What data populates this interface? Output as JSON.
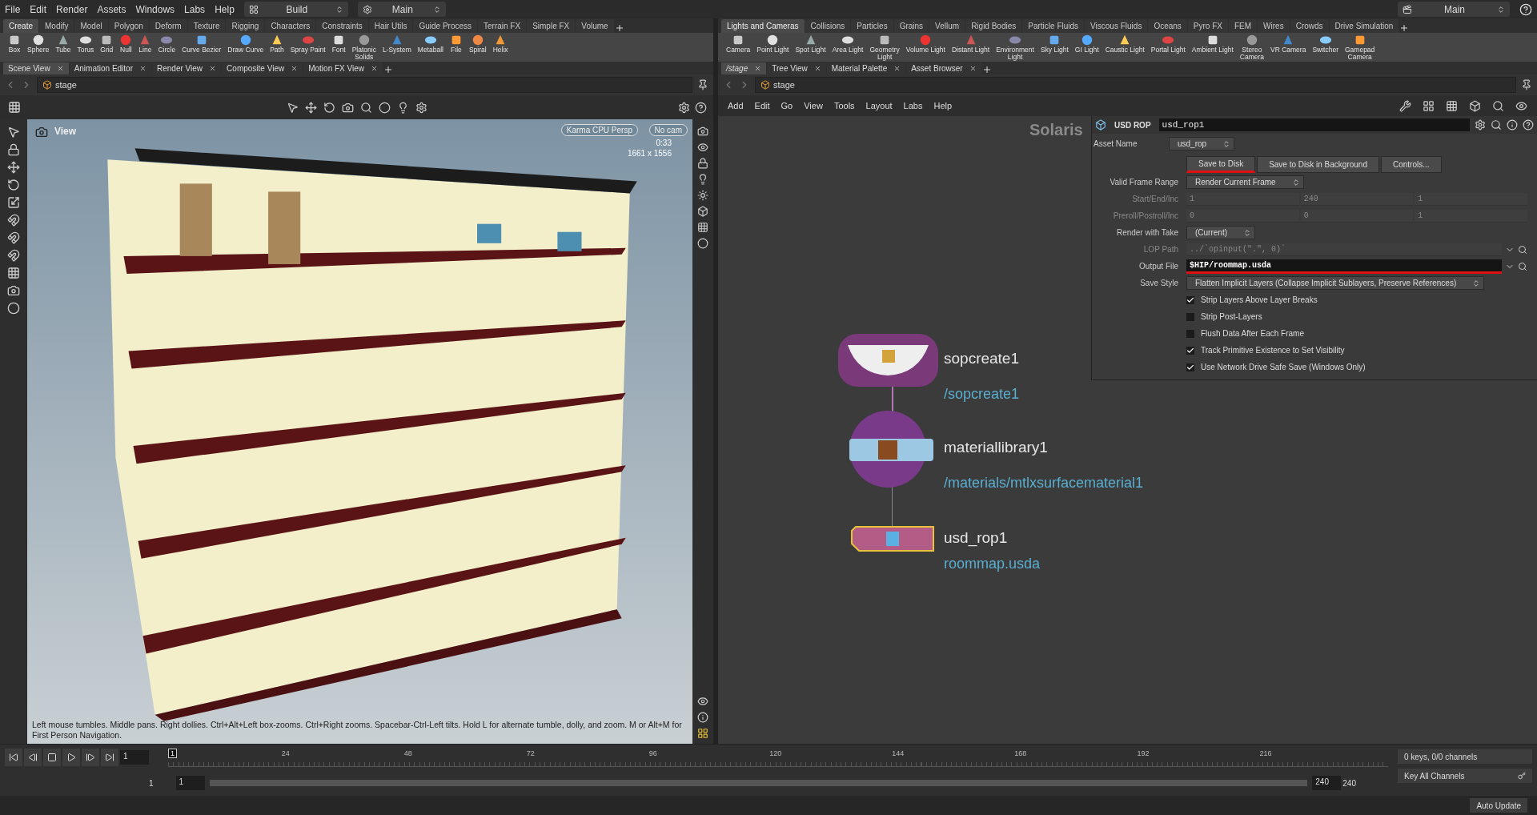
{
  "menu_bar": {
    "items": [
      "File",
      "Edit",
      "Render",
      "Assets",
      "Windows",
      "Labs",
      "Help"
    ],
    "desktop": "Build",
    "context": "Main"
  },
  "right_context": "Main",
  "left_shelf": {
    "tabs": [
      {
        "label": "Create",
        "selected": true
      },
      {
        "label": "Modify",
        "selected": false
      },
      {
        "label": "Model",
        "selected": false
      },
      {
        "label": "Polygon",
        "selected": false
      },
      {
        "label": "Deform",
        "selected": false
      },
      {
        "label": "Texture",
        "selected": false
      },
      {
        "label": "Rigging",
        "selected": false
      },
      {
        "label": "Characters",
        "selected": false
      },
      {
        "label": "Constraints",
        "selected": false
      },
      {
        "label": "Hair Utils",
        "selected": false
      },
      {
        "label": "Guide Process",
        "selected": false
      },
      {
        "label": "Terrain FX",
        "selected": false
      },
      {
        "label": "Simple FX",
        "selected": false
      },
      {
        "label": "Volume",
        "selected": false
      }
    ],
    "tools": [
      "Box",
      "Sphere",
      "Tube",
      "Torus",
      "Grid",
      "Null",
      "Line",
      "Circle",
      "Curve Bezier",
      "Draw Curve",
      "Path",
      "Spray Paint",
      "Font",
      "Platonic\nSolids",
      "L-System",
      "Metaball",
      "File",
      "Spiral",
      "Helix"
    ]
  },
  "right_shelf": {
    "tabs": [
      {
        "label": "Lights and Cameras",
        "selected": true
      },
      {
        "label": "Collisions",
        "selected": false
      },
      {
        "label": "Particles",
        "selected": false
      },
      {
        "label": "Grains",
        "selected": false
      },
      {
        "label": "Vellum",
        "selected": false
      },
      {
        "label": "Rigid Bodies",
        "selected": false
      },
      {
        "label": "Particle Fluids",
        "selected": false
      },
      {
        "label": "Viscous Fluids",
        "selected": false
      },
      {
        "label": "Oceans",
        "selected": false
      },
      {
        "label": "Pyro FX",
        "selected": false
      },
      {
        "label": "FEM",
        "selected": false
      },
      {
        "label": "Wires",
        "selected": false
      },
      {
        "label": "Crowds",
        "selected": false
      },
      {
        "label": "Drive Simulation",
        "selected": false
      }
    ],
    "tools": [
      "Camera",
      "Point Light",
      "Spot Light",
      "Area Light",
      "Geometry\nLight",
      "Volume Light",
      "Distant Light",
      "Environment\nLight",
      "Sky Light",
      "GI Light",
      "Caustic Light",
      "Portal Light",
      "Ambient Light",
      "Stereo\nCamera",
      "VR Camera",
      "Switcher",
      "Gamepad\nCamera"
    ]
  },
  "scene_pane": {
    "tabs": [
      {
        "label": "Scene View",
        "selected": true
      },
      {
        "label": "Animation Editor",
        "selected": false
      },
      {
        "label": "Render View",
        "selected": false
      },
      {
        "label": "Composite View",
        "selected": false
      },
      {
        "label": "Motion FX View",
        "selected": false
      }
    ],
    "path": "stage",
    "viewport": {
      "title": "View",
      "renderer": "Karma CPU  Persp",
      "camera": "No cam",
      "time": "0:33",
      "resolution": "1661 x 1556",
      "help": "Left mouse tumbles. Middle pans. Right dollies. Ctrl+Alt+Left box-zooms. Ctrl+Right zooms. Spacebar-Ctrl-Left tilts. Hold L for alternate tumble, dolly, and zoom. M or Alt+M for First Person Navigation."
    }
  },
  "network_pane": {
    "tabs": [
      {
        "label": "/stage",
        "selected": true
      },
      {
        "label": "Tree View",
        "selected": false
      },
      {
        "label": "Material Palette",
        "selected": false
      },
      {
        "label": "Asset Browser",
        "selected": false
      }
    ],
    "path": "stage",
    "menu": [
      "Add",
      "Edit",
      "Go",
      "View",
      "Tools",
      "Layout",
      "Labs",
      "Help"
    ],
    "context_label": "Solaris",
    "nodes": [
      {
        "kind": "sop_create",
        "name": "sopcreate1",
        "detail": "/sopcreate1"
      },
      {
        "kind": "material_library",
        "name": "materiallibrary1",
        "detail": "/materials/mtlxsurfacematerial1"
      },
      {
        "kind": "rop",
        "name": "usd_rop1",
        "detail": "roommap.usda"
      }
    ]
  },
  "parameters": {
    "node_type": "USD ROP",
    "node_name": "usd_rop1",
    "asset_label": "Asset Name",
    "asset_name": "usd_rop",
    "buttons": [
      {
        "label": "Save to Disk",
        "highlighted": true
      },
      {
        "label": "Save to Disk in Background",
        "highlighted": false
      },
      {
        "label": "Controls...",
        "highlighted": false
      }
    ],
    "rows": [
      {
        "kind": "menu",
        "label": "Valid Frame Range",
        "value": "Render Current Frame",
        "disabled": false
      },
      {
        "kind": "triple",
        "label": "Start/End/Inc",
        "values": [
          "1",
          "240",
          "1"
        ],
        "disabled": true
      },
      {
        "kind": "triple",
        "label": "Preroll/Postroll/Inc",
        "values": [
          "0",
          "0",
          "1"
        ],
        "disabled": true
      },
      {
        "kind": "menu",
        "label": "Render with Take",
        "value": "(Current)",
        "disabled": false
      },
      {
        "kind": "field",
        "label": "LOP Path",
        "value": "../`opinput(\".\", 0)`",
        "disabled": true,
        "highlighted": false
      },
      {
        "kind": "field",
        "label": "Output File",
        "value": "$HIP/roommap.usda",
        "disabled": false,
        "highlighted": true
      },
      {
        "kind": "menu",
        "label": "Save Style",
        "value": "Flatten Implicit Layers (Collapse Implicit Sublayers, Preserve References)",
        "disabled": false
      },
      {
        "kind": "toggle",
        "label": "Strip Layers Above Layer Breaks",
        "checked": true
      },
      {
        "kind": "toggle",
        "label": "Strip Post-Layers",
        "checked": false
      },
      {
        "kind": "toggle",
        "label": "Flush Data After Each Frame",
        "checked": false
      },
      {
        "kind": "toggle",
        "label": "Track Primitive Existence to Set Visibility",
        "checked": true
      },
      {
        "kind": "toggle",
        "label": "Use Network Drive Safe Save (Windows Only)",
        "checked": true
      }
    ]
  },
  "timeline": {
    "frame": "1",
    "current_marker": "1",
    "ticks": [
      "24",
      "48",
      "72",
      "96",
      "120",
      "144",
      "168",
      "192",
      "216"
    ],
    "range_start": "1",
    "playback_start": "1",
    "playback_end": "240",
    "range_end": "240",
    "keys_info": "0 keys, 0/0 channels",
    "key_mode": "Key All Channels"
  },
  "status_bar": {
    "update_mode": "Auto Update"
  }
}
